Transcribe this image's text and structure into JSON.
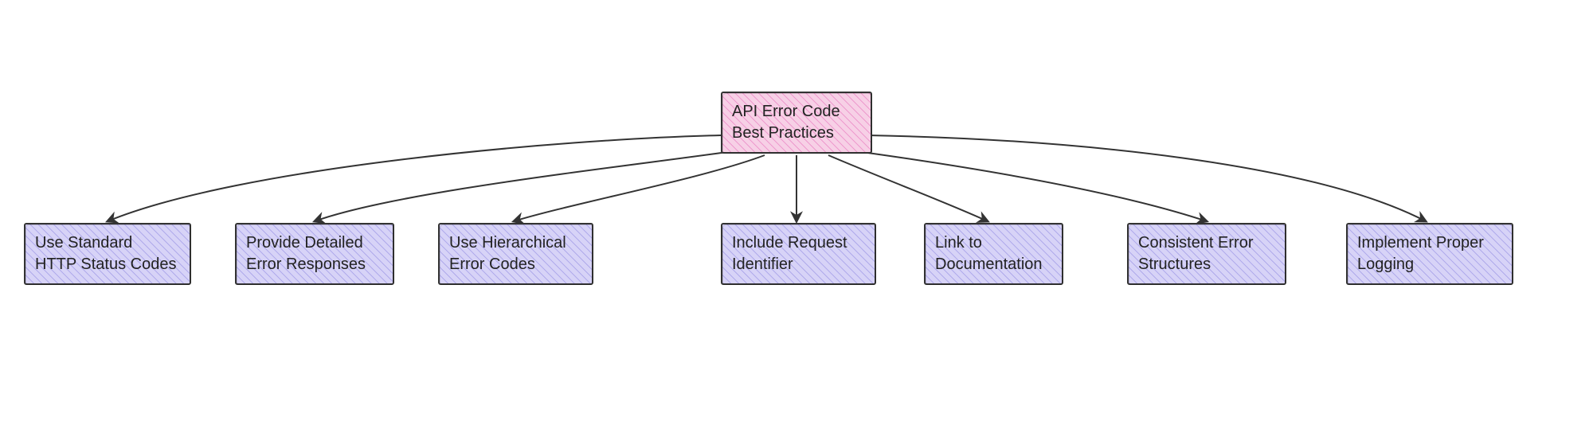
{
  "root": {
    "line1": "API Error Code",
    "line2": "Best Practices"
  },
  "children": [
    {
      "line1": "Use Standard",
      "line2": "HTTP Status Codes"
    },
    {
      "line1": "Provide Detailed",
      "line2": "Error Responses"
    },
    {
      "line1": "Use Hierarchical",
      "line2": "Error Codes"
    },
    {
      "line1": "Include Request",
      "line2": "Identifier"
    },
    {
      "line1": "Link to",
      "line2": "Documentation"
    },
    {
      "line1": "Consistent Error",
      "line2": "Structures"
    },
    {
      "line1": "Implement Proper",
      "line2": "Logging"
    }
  ],
  "colors": {
    "root_fill": "#f7d0e6",
    "child_fill": "#d7d3f7",
    "stroke": "#333333"
  }
}
